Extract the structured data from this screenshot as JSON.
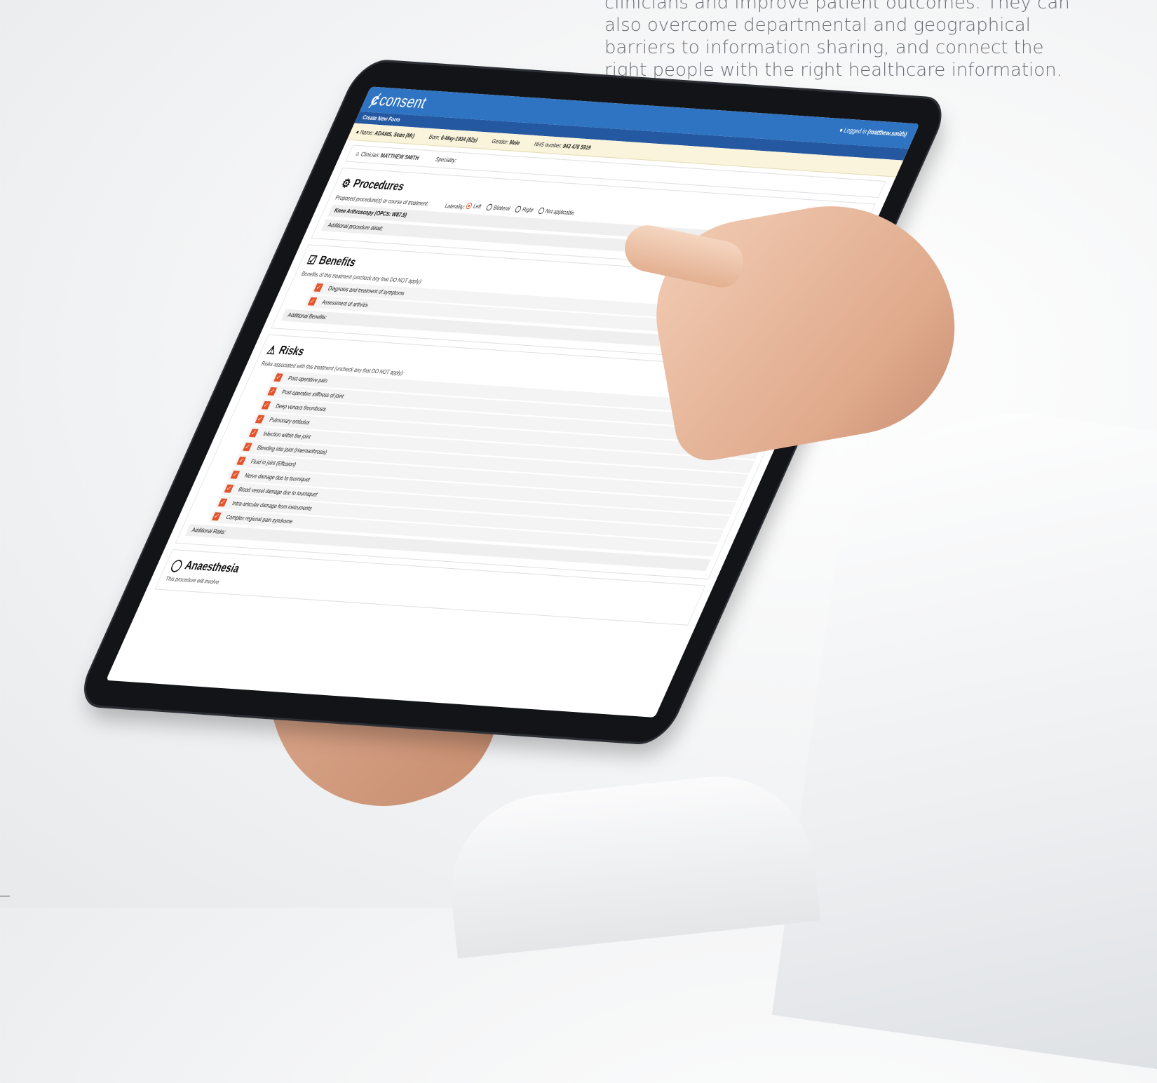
{
  "intro": {
    "lines": [
      "clinicians and improve patient outcomes. They can",
      "also overcome departmental and geographical",
      "barriers to information sharing, and connect the",
      "right people with the right healthcare information."
    ]
  },
  "app": {
    "brand": "consent",
    "login_prefix": "Logged in",
    "login_user": "(matthew.smith)",
    "subbar": "Create New Form"
  },
  "patient": {
    "name_label": "Name:",
    "name": "ADAMS, Sean (Mr)",
    "born_label": "Born:",
    "born": "6-May-1934 (82y)",
    "gender_label": "Gender:",
    "gender": "Male",
    "nhs_label": "NHS number:",
    "nhs": "943 476 5919"
  },
  "clinician": {
    "label": "Clinician:",
    "name": "MATTHEW SMITH",
    "speciality_label": "Speciality:"
  },
  "procedures": {
    "title": "Procedures",
    "proposed_label": "Proposed procedure(s) or course of treatment:",
    "procedure": "Knee Arthroscopy (OPCS: W87.9)",
    "laterality_label": "Laterality:",
    "laterality_options": [
      "Left",
      "Bilateral",
      "Right",
      "Not applicable"
    ],
    "laterality_selected": "Left",
    "detail_label": "Additional procedure detail:"
  },
  "benefits": {
    "title": "Benefits",
    "label": "Benefits of this treatment (uncheck any that DO NOT apply):",
    "items": [
      "Diagnosis and treatment of symptoms",
      "Assessment of arthritis"
    ],
    "additional_label": "Additional Benefits:"
  },
  "risks": {
    "title": "Risks",
    "label": "Risks associated with this treatment (uncheck any that DO NOT apply):",
    "items": [
      "Post-operative pain",
      "Post-operative stiffness of joint",
      "Deep venous thrombosis",
      "Pulmonary embolus",
      "Infection within the joint",
      "Bleeding into joint (Haemarthrosis)",
      "Fluid in joint (Effusion)",
      "Nerve damage due to tourniquet",
      "Blood vessel damage due to tourniquet",
      "Intra-articular damage from instruments",
      "Complex regional pain syndrome"
    ],
    "additional_label": "Additional Risks:"
  },
  "anaesthesia": {
    "title": "Anaesthesia",
    "label": "This procedure will involve:"
  },
  "colors": {
    "brand_blue": "#2e74c2",
    "check_orange": "#e3542d",
    "patient_bar": "#fbf4dc"
  },
  "icons": {
    "procedures": "gear-icon",
    "benefits": "clipboard-check-icon",
    "risks": "warning-icon",
    "anaesthesia": "pill-icon",
    "clinician": "clinician-icon",
    "patient": "user-icon"
  }
}
